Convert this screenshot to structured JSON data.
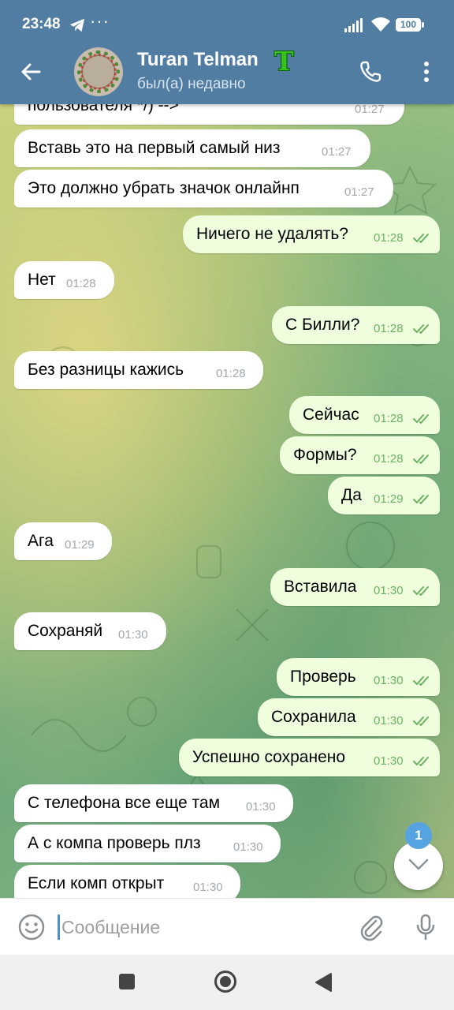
{
  "status_bar": {
    "time": "23:48",
    "dots": "···",
    "battery": "100"
  },
  "header": {
    "name": "Turan Telman",
    "emoji": "T",
    "status": "был(а) недавно"
  },
  "messages": [
    {
      "dir": "in",
      "text": "пользователя */) -->",
      "time": "01:27"
    },
    {
      "dir": "in",
      "text": "Вставь это на первый самый низ",
      "time": "01:27"
    },
    {
      "dir": "in",
      "text": "Это должно убрать значок онлайнп",
      "time": "01:27"
    },
    {
      "dir": "out",
      "text": "Ничего не удалять?",
      "time": "01:28",
      "read": true
    },
    {
      "dir": "in",
      "text": "Нет",
      "time": "01:28"
    },
    {
      "dir": "out",
      "text": "С Билли?",
      "time": "01:28",
      "read": true
    },
    {
      "dir": "in",
      "text": "Без разницы кажись",
      "time": "01:28"
    },
    {
      "dir": "out",
      "text": "Сейчас",
      "time": "01:28",
      "read": true
    },
    {
      "dir": "out",
      "text": "Формы?",
      "time": "01:28",
      "read": true
    },
    {
      "dir": "out",
      "text": "Да",
      "time": "01:29",
      "read": true
    },
    {
      "dir": "in",
      "text": "Ага",
      "time": "01:29"
    },
    {
      "dir": "out",
      "text": "Вставила",
      "time": "01:30",
      "read": true
    },
    {
      "dir": "in",
      "text": "Сохраняй",
      "time": "01:30"
    },
    {
      "dir": "out",
      "text": "Проверь",
      "time": "01:30",
      "read": true
    },
    {
      "dir": "out",
      "text": "Сохранила",
      "time": "01:30",
      "read": true
    },
    {
      "dir": "out",
      "text": "Успешно сохранено",
      "time": "01:30",
      "read": true
    },
    {
      "dir": "in",
      "text": "С телефона все еще там",
      "time": "01:30"
    },
    {
      "dir": "in",
      "text": "А с компа проверь плз",
      "time": "01:30"
    },
    {
      "dir": "in",
      "text": "Если комп открыт",
      "time": "01:30"
    }
  ],
  "scroll_button": {
    "unread_count": "1"
  },
  "composer": {
    "placeholder": "Сообщение"
  },
  "colors": {
    "header": "#517da2",
    "incoming_bubble": "#ffffff",
    "outgoing_bubble": "#effedd",
    "outgoing_time": "#6cb262",
    "unread_badge": "#56a3e1"
  }
}
